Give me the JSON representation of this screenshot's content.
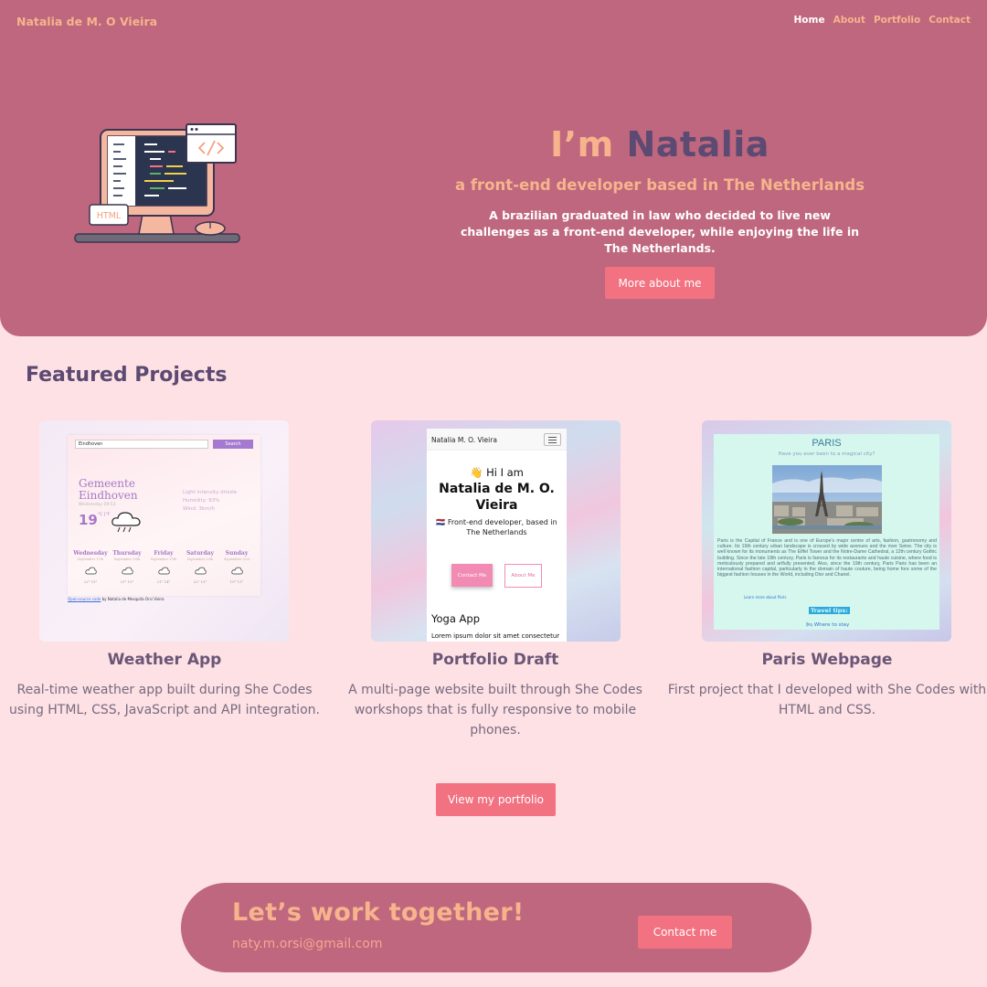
{
  "brand": "Natalia de M. O Vieira",
  "nav": [
    {
      "label": "Home",
      "active": true
    },
    {
      "label": "About"
    },
    {
      "label": "Portfolio"
    },
    {
      "label": "Contact"
    }
  ],
  "hero": {
    "title_prefix": "I’m",
    "title_name": "Natalia",
    "subtitle": "a front-end developer based in The Netherlands",
    "description": "A brazilian graduated in law who decided to live new challenges as a front-end developer, while enjoying the life in The Netherlands.",
    "button": "More about me",
    "illustration_label": "HTML"
  },
  "featured": {
    "title": "Featured Projects",
    "projects": [
      {
        "title": "Weather App",
        "description": "Real-time weather app built during She Codes using HTML, CSS, JavaScript and API integration.",
        "preview": {
          "search_value": "Eindhoven",
          "search_button": "Search",
          "city": "Gemeente Eindhoven",
          "date": "Wednesday 09:53",
          "temp": "19",
          "unit": "°C |°F",
          "condition": "Light intensity drizzle",
          "humidity": "Humidity: 93%",
          "wind": "Wind: 3km/h",
          "days": [
            {
              "name": "Wednesday",
              "date": "September 17th",
              "temps": "22°  15°"
            },
            {
              "name": "Thursday",
              "date": "September 18th",
              "temps": "21°  15°"
            },
            {
              "name": "Friday",
              "date": "September 19th",
              "temps": "21°  14°"
            },
            {
              "name": "Saturday",
              "date": "September 20th",
              "temps": "22°  15°"
            },
            {
              "name": "Sunday",
              "date": "September 21st",
              "temps": "19°  13°"
            }
          ],
          "footer_link": "Open-source code",
          "footer_text": " by Natalia de Mesquita Orsi Vieira"
        }
      },
      {
        "title": "Portfolio Draft",
        "description": "A multi-page website built through She Codes workshops that is fully responsive to mobile phones.",
        "preview": {
          "navbar_brand": "Natalia M. O. Vieira",
          "greeting": "👋 Hi I am",
          "name": "Natalia de M. O. Vieira",
          "subtitle": "🇳🇱 Front-end developer, based in The Netherlands",
          "button_primary": "Contact Me",
          "button_secondary": "About Me",
          "section_title": "Yoga App",
          "lorem": "Lorem ipsum dolor sit amet consectetur adipisicing elit. Perferendis quia, dignissimos"
        }
      },
      {
        "title": "Paris Webpage",
        "description": "First project that I developed with She Codes with HTML and CSS.",
        "preview": {
          "heading": "PARIS",
          "question": "Have you ever been to a magical city?",
          "paragraph": "Paris is the Capital of France and is one of Europe's major centre of arts, fashion, gastronomy and culture. Its 19th century urban landscape is crossed by wide avenues and the river Seine. The city is well known for its monuments as The Eiffel Tower and the Notre-Dame Cathedral, a 12th century Gothic building. Since the late 18th century, Paris is famous for its restaurants and haute cuisine, where food is meticulously prepared and artfully presented. Also, since the 19th century, Paris Paris has been an international fashion capital, particularly in the domain of haute couture, being home fore some of the biggest fashion houses in the World, including Dior and Chanel.",
          "learn_more": "Learn more about Paris",
          "travel_tips": "Travel tips:",
          "where_to_stay": "🛏 Where to stay"
        }
      }
    ],
    "button": "View my portfolio"
  },
  "cta": {
    "title": "Let’s work together!",
    "email": "naty.m.orsi@gmail.com",
    "button": "Contact me"
  },
  "colors": {
    "background": "#fde1e4",
    "hero": "#be677e",
    "accent": "#f7b48c",
    "dark_purple": "#5c4a72",
    "button": "#f27281"
  }
}
